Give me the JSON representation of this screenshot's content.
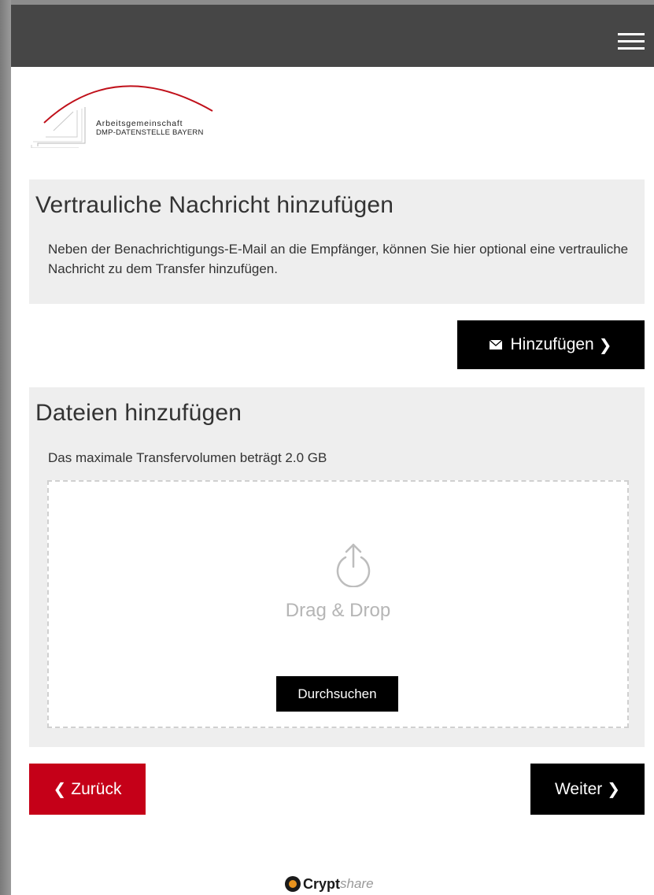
{
  "header": {
    "menu_icon": "hamburger-menu-icon"
  },
  "logo": {
    "line1": "Arbeitsgemeinschaft",
    "line2": "DMP-DATENSTELLE BAYERN"
  },
  "message_section": {
    "title": "Vertrauliche Nachricht hinzufügen",
    "description": "Neben der Benachrichtigungs-E-Mail an die Empfänger, können Sie hier optional eine vertrauliche Nachricht zu dem Transfer hinzufügen.",
    "add_button_label": "Hinzufügen",
    "add_button_icon": "envelope-icon"
  },
  "files_section": {
    "title": "Dateien hinzufügen",
    "description": "Das maximale Transfervolumen beträgt 2.0 GB",
    "dropzone_label": "Drag & Drop",
    "dropzone_icon": "upload-icon",
    "browse_label": "Durchsuchen"
  },
  "navigation": {
    "back_label": "Zurück",
    "next_label": "Weiter"
  },
  "footer": {
    "brand_bold": "Crypt",
    "brand_light": "share"
  },
  "colors": {
    "topbar": "#464646",
    "panel": "#eeeeee",
    "primary_button": "#000000",
    "back_button": "#c50018",
    "logo_accent": "#c0101a"
  }
}
